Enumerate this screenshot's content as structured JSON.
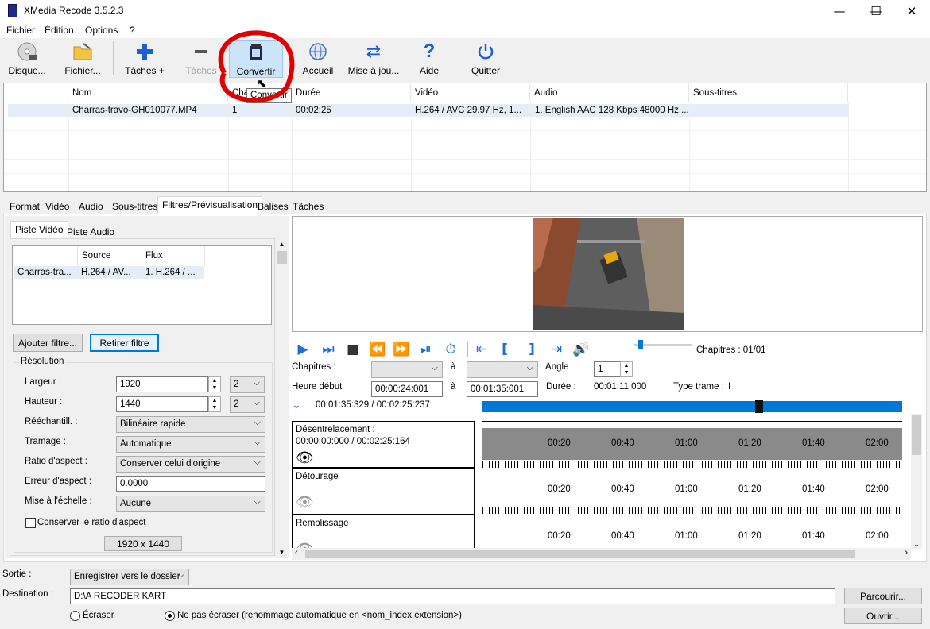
{
  "window": {
    "title": "XMedia Recode 3.5.2.3",
    "minimize": "—",
    "maximize": "☐",
    "close": "✕"
  },
  "menu": [
    "Fichier",
    "Édition",
    "Options",
    "?"
  ],
  "toolbar": {
    "disc": "Disque...",
    "file": "Fichier...",
    "add_task": "Tâches +",
    "remove_task": "Tâches",
    "convert": "Convertir",
    "home": "Accueil",
    "update": "Mise à jou...",
    "help": "Aide",
    "quit": "Quitter",
    "tooltip": "Convertir"
  },
  "filelist": {
    "headers": [
      "Nom",
      "Cha",
      "Durée",
      "Vidéo",
      "Audio",
      "Sous-titres"
    ],
    "rows": [
      [
        "Charras-travo-GH010077.MP4",
        "1",
        "00:02:25",
        "H.264 / AVC  29.97 Hz, 1...",
        "1. English AAC  128 Kbps 48000 Hz ...",
        ""
      ]
    ]
  },
  "tabs": [
    "Format",
    "Vidéo",
    "Audio",
    "Sous-titres",
    "Filtres/Prévisualisation",
    "Balises",
    "Tâches"
  ],
  "subtabs": [
    "Piste Vidéo",
    "Piste Audio"
  ],
  "track_table": {
    "headers": [
      "",
      "Source",
      "Flux"
    ],
    "row": [
      "Charras-tra...",
      "H.264 / AV...",
      "1. H.264 / ..."
    ]
  },
  "buttons": {
    "add_filter": "Ajouter filtre...",
    "remove_filter": "Retirer filtre",
    "browse": "Parcourir...",
    "open": "Ouvrir..."
  },
  "resolution": {
    "group": "Résolution",
    "width_label": "Largeur :",
    "width": "1920",
    "width_mult": "2",
    "height_label": "Hauteur :",
    "height": "1440",
    "height_mult": "2",
    "resample_label": "Rééchantill. :",
    "resample": "Bilinéaire rapide",
    "dither_label": "Tramage :",
    "dither": "Automatique",
    "aspect_label": "Ratio d'aspect :",
    "aspect": "Conserver celui d'origine",
    "aspect_err_label": "Erreur d'aspect :",
    "aspect_err": "0.0000",
    "scale_label": "Mise à l'échelle :",
    "scale": "Aucune",
    "keep_ratio": "Conserver le ratio d'aspect",
    "size_display": "1920 x 1440"
  },
  "preview": {
    "chapters_info": "Chapitres : 01/01",
    "chapters_label": "Chapitres :",
    "to": "à",
    "angle_label": "Angle",
    "angle": "1",
    "start_label": "Heure début",
    "start": "00:00:24:001",
    "end": "00:01:35:001",
    "duration_label": "Durée :",
    "duration": "00:01:11:000",
    "frame_type_label": "Type trame :",
    "frame_type": "I",
    "position": "00:01:35:329 / 00:02:25:237",
    "seek_fraction": 0.65
  },
  "filters": [
    {
      "name": "Désentrelacement :",
      "time": "00:00:00:000 / 00:02:25:164",
      "enabled": true
    },
    {
      "name": "Détourage",
      "time": "",
      "enabled": false
    },
    {
      "name": "Remplissage",
      "time": "",
      "enabled": false
    }
  ],
  "timeline_ticks": [
    "00:20",
    "00:40",
    "01:00",
    "01:20",
    "01:40",
    "02:00"
  ],
  "output": {
    "label": "Sortie :",
    "mode": "Enregistrer vers le dossier",
    "dest_label": "Destination :",
    "dest": "D:\\A RECODER KART",
    "overwrite": "Écraser",
    "no_overwrite": "Ne pas écraser (renommage automatique en <nom_index.extension>)"
  },
  "colors": {
    "accent": "#0078d7",
    "annotation": "#e00000"
  }
}
